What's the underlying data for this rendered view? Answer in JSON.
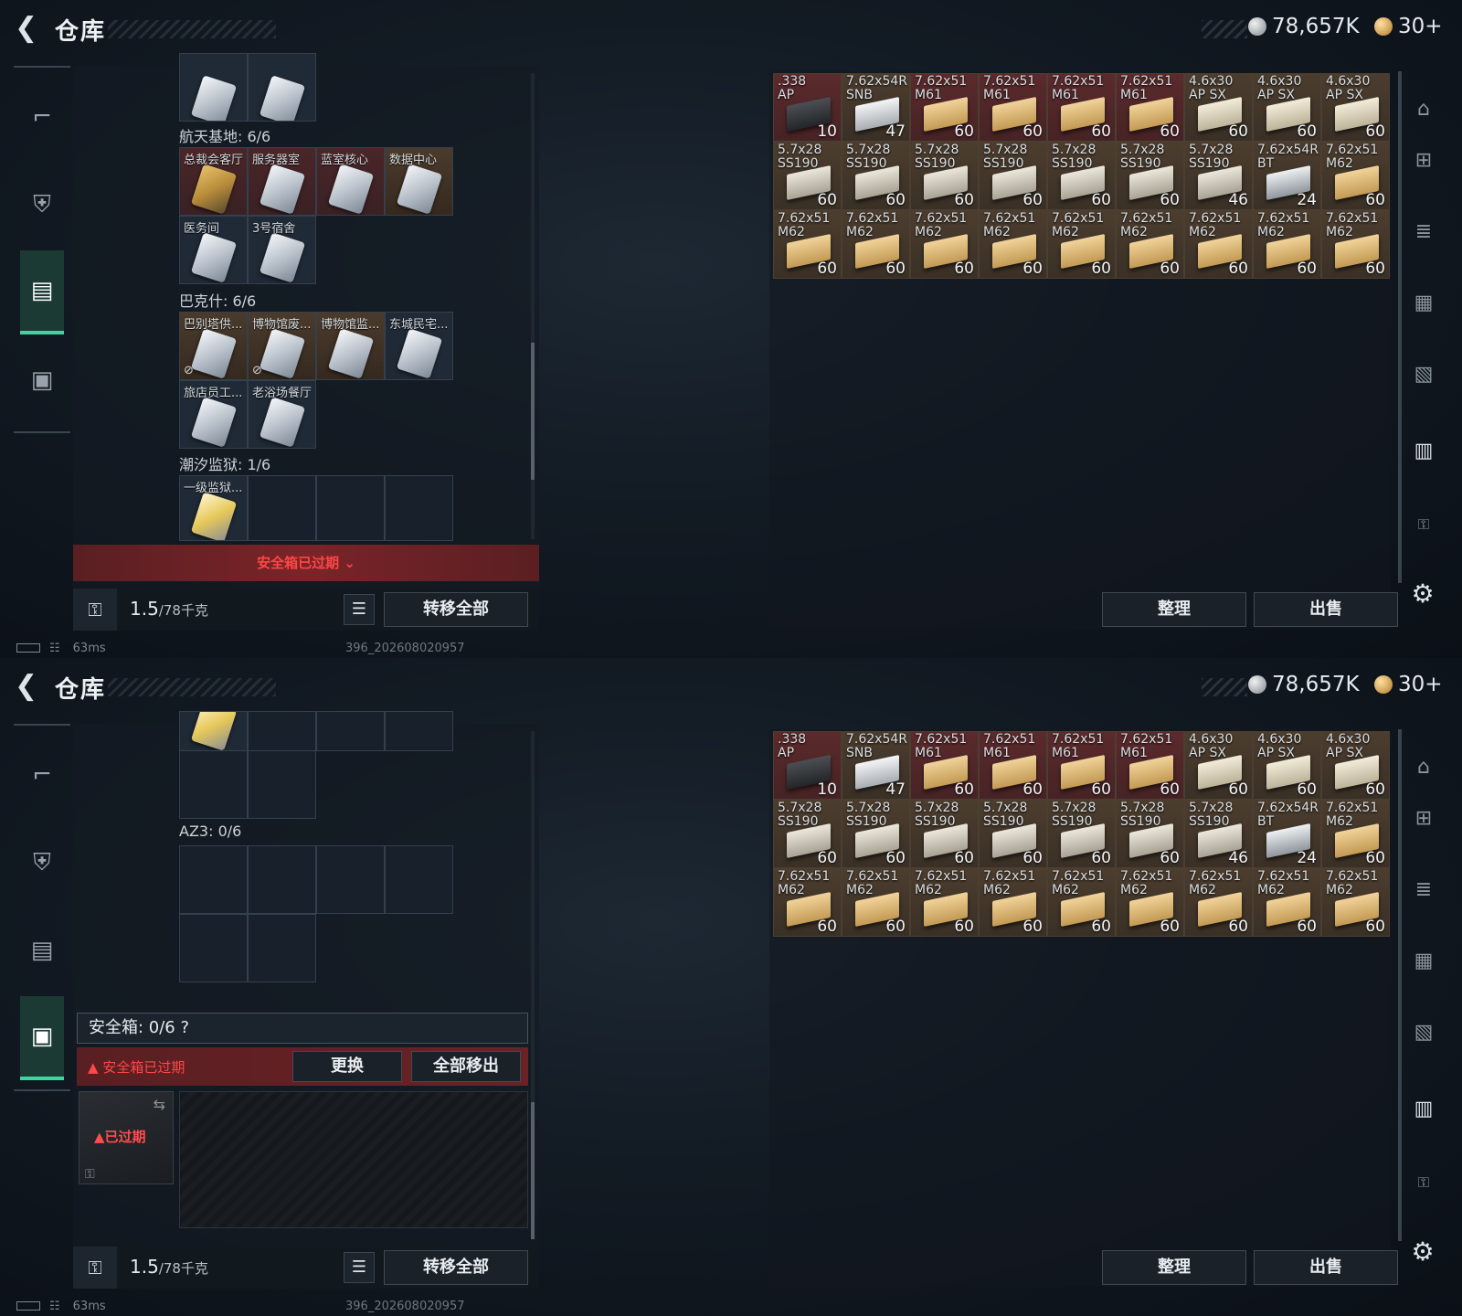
{
  "header": {
    "back_icon": "chevron-left-icon",
    "title": "仓库",
    "silver": "78,657K",
    "gold": "30+"
  },
  "left_sidebar": [
    "gun-icon",
    "armor-icon",
    "backpack-icon",
    "safebox-icon"
  ],
  "keycards": {
    "aerospace": {
      "label": "航天基地: 6/6",
      "cards": [
        "总裁会客厅",
        "服务器室",
        "蓝室核心",
        "数据中心",
        "医务间",
        "3号宿舍"
      ]
    },
    "bakesh": {
      "label": "巴克什: 6/6",
      "cards": [
        "巴别塔供...",
        "博物馆废...",
        "博物馆监...",
        "东城民宅...",
        "旅店员工...",
        "老浴场餐厅"
      ]
    },
    "tidal": {
      "label": "潮汐监狱: 1/6",
      "cards": [
        "一级监狱..."
      ]
    },
    "az3": {
      "label": "AZ3: 0/6"
    }
  },
  "expired_banner": "安全箱已过期",
  "weight": {
    "current": "1.5",
    "max": "/78千克"
  },
  "buttons": {
    "transfer_all": "转移全部",
    "organize": "整理",
    "sell": "出售",
    "replace": "更换",
    "remove_all": "全部移出"
  },
  "safebox": {
    "title": "安全箱: 0/6",
    "help": "?",
    "warning": "安全箱已过期",
    "slot_status": "已过期"
  },
  "status": {
    "ping": "63ms",
    "uid": "396_202608020957"
  },
  "stash_items": [
    {
      "name": ".338\nAP",
      "count": "10",
      "bg": "red",
      "box": "dark"
    },
    {
      "name": "7.62x54R\nSNB",
      "count": "47",
      "bg": "brown",
      "box": "white"
    },
    {
      "name": "7.62x51\nM61",
      "count": "60",
      "bg": "red",
      "box": "tan"
    },
    {
      "name": "7.62x51\nM61",
      "count": "60",
      "bg": "red",
      "box": "tan"
    },
    {
      "name": "7.62x51\nM61",
      "count": "60",
      "bg": "red",
      "box": "tan"
    },
    {
      "name": "7.62x51\nM61",
      "count": "60",
      "bg": "red",
      "box": "tan"
    },
    {
      "name": "4.6x30\nAP SX",
      "count": "60",
      "bg": "brown",
      "box": "cream"
    },
    {
      "name": "4.6x30\nAP SX",
      "count": "60",
      "bg": "brown",
      "box": "cream"
    },
    {
      "name": "4.6x30\nAP SX",
      "count": "60",
      "bg": "brown",
      "box": "cream"
    },
    {
      "name": "5.7x28\nSS190",
      "count": "60",
      "bg": "brown",
      "box": "pale"
    },
    {
      "name": "5.7x28\nSS190",
      "count": "60",
      "bg": "brown",
      "box": "pale"
    },
    {
      "name": "5.7x28\nSS190",
      "count": "60",
      "bg": "brown",
      "box": "pale"
    },
    {
      "name": "5.7x28\nSS190",
      "count": "60",
      "bg": "brown",
      "box": "pale"
    },
    {
      "name": "5.7x28\nSS190",
      "count": "60",
      "bg": "brown",
      "box": "pale"
    },
    {
      "name": "5.7x28\nSS190",
      "count": "60",
      "bg": "brown",
      "box": "pale"
    },
    {
      "name": "5.7x28\nSS190",
      "count": "46",
      "bg": "brown",
      "box": "pale"
    },
    {
      "name": "7.62x54R\nBT",
      "count": "24",
      "bg": "brown",
      "box": "grey"
    },
    {
      "name": "7.62x51\nM62",
      "count": "60",
      "bg": "brown",
      "box": "tan"
    },
    {
      "name": "7.62x51\nM62",
      "count": "60",
      "bg": "brown",
      "box": "tan"
    },
    {
      "name": "7.62x51\nM62",
      "count": "60",
      "bg": "brown",
      "box": "tan"
    },
    {
      "name": "7.62x51\nM62",
      "count": "60",
      "bg": "brown",
      "box": "tan"
    },
    {
      "name": "7.62x51\nM62",
      "count": "60",
      "bg": "brown",
      "box": "tan"
    },
    {
      "name": "7.62x51\nM62",
      "count": "60",
      "bg": "brown",
      "box": "tan"
    },
    {
      "name": "7.62x51\nM62",
      "count": "60",
      "bg": "brown",
      "box": "tan"
    },
    {
      "name": "7.62x51\nM62",
      "count": "60",
      "bg": "brown",
      "box": "tan"
    },
    {
      "name": "7.62x51\nM62",
      "count": "60",
      "bg": "brown",
      "box": "tan"
    },
    {
      "name": "7.62x51\nM62",
      "count": "60",
      "bg": "brown",
      "box": "tan"
    }
  ],
  "right_sidebar": [
    "helmet-icon",
    "add-container-icon",
    "rifle-container-icon",
    "gear-container-icon",
    "case-container-icon",
    "storage-container-icon",
    "lock-icon"
  ],
  "colors": {
    "active_green": "#3fd4a0",
    "danger_red": "#ff4646"
  }
}
